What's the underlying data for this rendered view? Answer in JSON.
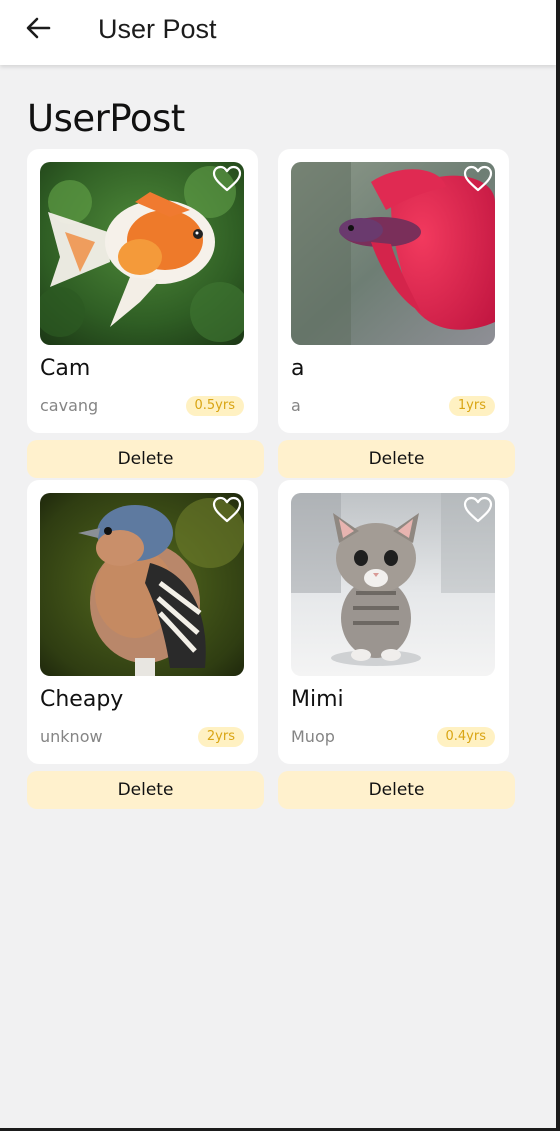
{
  "appbar": {
    "title": "User Post",
    "back_icon": "arrow-left-icon"
  },
  "heading": "UserPost",
  "posts": [
    {
      "name": "Cam",
      "breed": "cavang",
      "age": "0.5yrs",
      "image": "goldfish",
      "favorite_icon": "heart-outline-icon"
    },
    {
      "name": "a",
      "breed": "a",
      "age": "1yrs",
      "image": "betta-fish",
      "favorite_icon": "heart-outline-icon"
    },
    {
      "name": "Cheapy",
      "breed": "unknow",
      "age": "2yrs",
      "image": "finch-bird",
      "favorite_icon": "heart-outline-icon"
    },
    {
      "name": "Mimi",
      "breed": "Muop",
      "age": "0.4yrs",
      "image": "tabby-kitten",
      "favorite_icon": "heart-outline-icon"
    }
  ],
  "delete_label": "Delete",
  "colors": {
    "background": "#f1f1f2",
    "card": "#ffffff",
    "badge_bg": "#fff1c2",
    "badge_text": "#d9a514",
    "delete_bg": "#fff1cd"
  }
}
